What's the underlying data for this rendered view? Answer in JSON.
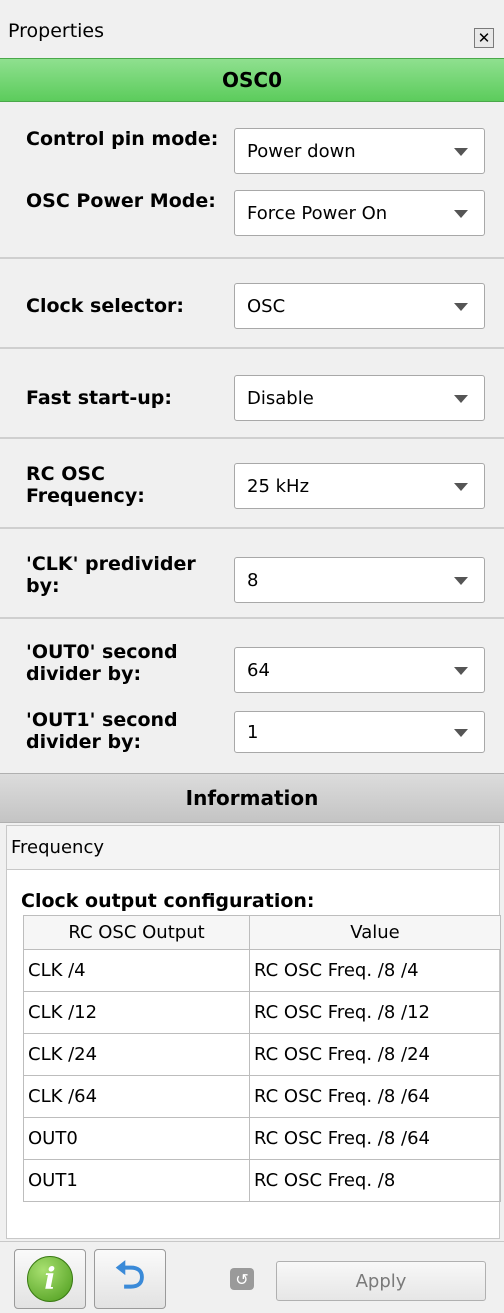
{
  "panel": {
    "title": "Properties",
    "close_glyph": "✕"
  },
  "component": {
    "name": "OSC0"
  },
  "fields": [
    {
      "label": "Control pin mode:",
      "value": "Power down"
    },
    {
      "label": "OSC Power Mode:",
      "value": "Force Power On"
    },
    {
      "label": "Clock selector:",
      "value": "OSC"
    },
    {
      "label": "Fast start-up:",
      "value": "Disable"
    },
    {
      "label": "RC OSC Frequency:",
      "value": "25 kHz"
    },
    {
      "label": "'CLK' predivider by:",
      "value": "8"
    },
    {
      "label": "'OUT0' second divider by:",
      "value": "64"
    },
    {
      "label": "'OUT1' second divider by:",
      "value": "1"
    }
  ],
  "information": {
    "header": "Information",
    "tab": "Frequency",
    "config_title": "Clock output configuration:",
    "table": {
      "headers": [
        "RC OSC Output",
        "Value"
      ],
      "rows": [
        [
          "CLK /4",
          "RC OSC Freq. /8 /4"
        ],
        [
          "CLK /12",
          "RC OSC Freq. /8 /12"
        ],
        [
          "CLK /24",
          "RC OSC Freq. /8 /24"
        ],
        [
          "CLK /64",
          "RC OSC Freq. /8 /64"
        ],
        [
          "OUT0",
          "RC OSC Freq. /8 /64"
        ],
        [
          "OUT1",
          "RC OSC Freq. /8"
        ]
      ]
    }
  },
  "footer": {
    "info_glyph": "i",
    "undo_glyph": "⮌",
    "small_undo_glyph": "↺",
    "apply_label": "Apply"
  },
  "colors": {
    "component_header": "#5ccc5c",
    "info_icon": "#4a9a1a",
    "undo_icon": "#3a8ad8"
  },
  "icons": {
    "close": "close-icon",
    "info": "info-icon",
    "undo": "undo-icon",
    "dropdown": "chevron-down-icon"
  }
}
